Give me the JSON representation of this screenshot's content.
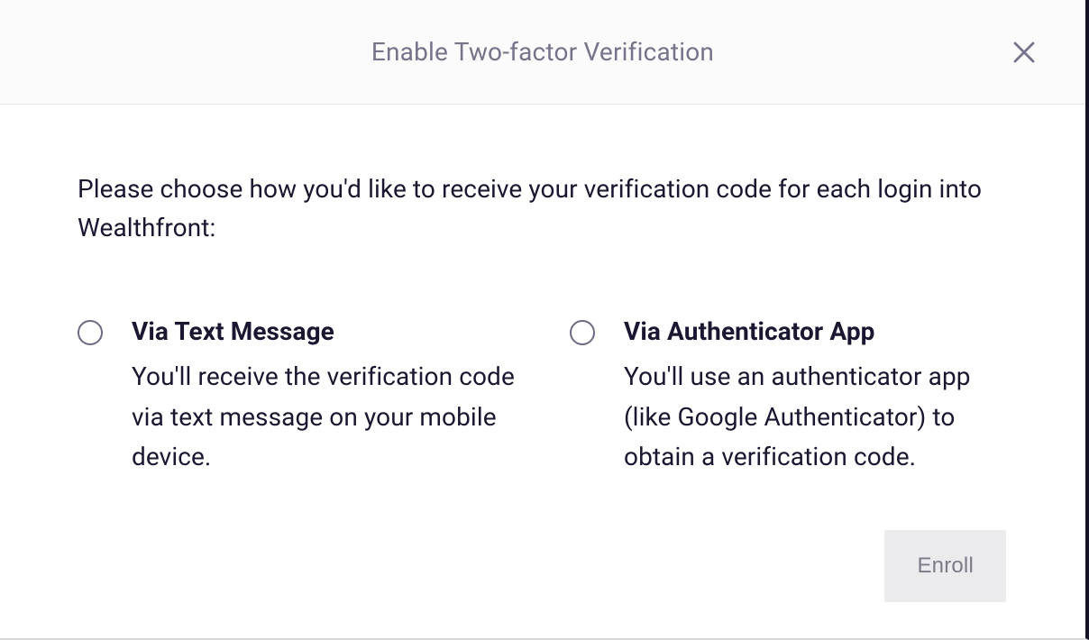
{
  "modal": {
    "title": "Enable Two-factor Verification",
    "intro": "Please choose how you'd like to receive your verification code for each login into Wealthfront:",
    "options": [
      {
        "title": "Via Text Message",
        "description": "You'll receive the verification code via text message on your mobile device."
      },
      {
        "title": "Via Authenticator App",
        "description": "You'll use an authenticator app (like Google Authenticator) to obtain a verification code."
      }
    ],
    "enroll_label": "Enroll"
  }
}
